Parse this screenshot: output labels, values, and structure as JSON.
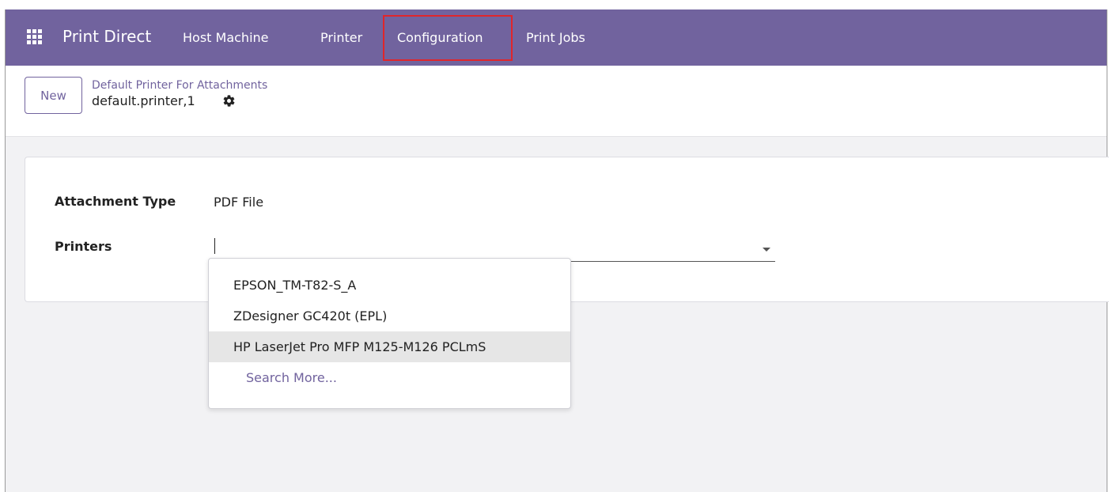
{
  "navbar": {
    "app_title": "Print Direct",
    "menu": [
      {
        "label": "Host Machine"
      },
      {
        "label": "Printer"
      },
      {
        "label": "Configuration"
      },
      {
        "label": "Print Jobs"
      }
    ],
    "highlighted_item": "Configuration",
    "background_color": "#71639e",
    "highlight_color": "#e0262b"
  },
  "control_panel": {
    "new_button_label": "New",
    "breadcrumb_parent": "Default Printer For Attachments",
    "record_name": "default.printer,1",
    "gear_icon": "gear-icon"
  },
  "form": {
    "attachment_type": {
      "label": "Attachment Type",
      "value": "PDF File"
    },
    "printers": {
      "label": "Printers",
      "value": ""
    }
  },
  "dropdown": {
    "options": [
      {
        "label": "EPSON_TM-T82-S_A"
      },
      {
        "label": "ZDesigner GC420t (EPL)"
      },
      {
        "label": "HP LaserJet Pro MFP M125-M126 PCLmS"
      }
    ],
    "highlighted_option": "HP LaserJet Pro MFP M125-M126 PCLmS",
    "search_more_label": "Search More..."
  }
}
